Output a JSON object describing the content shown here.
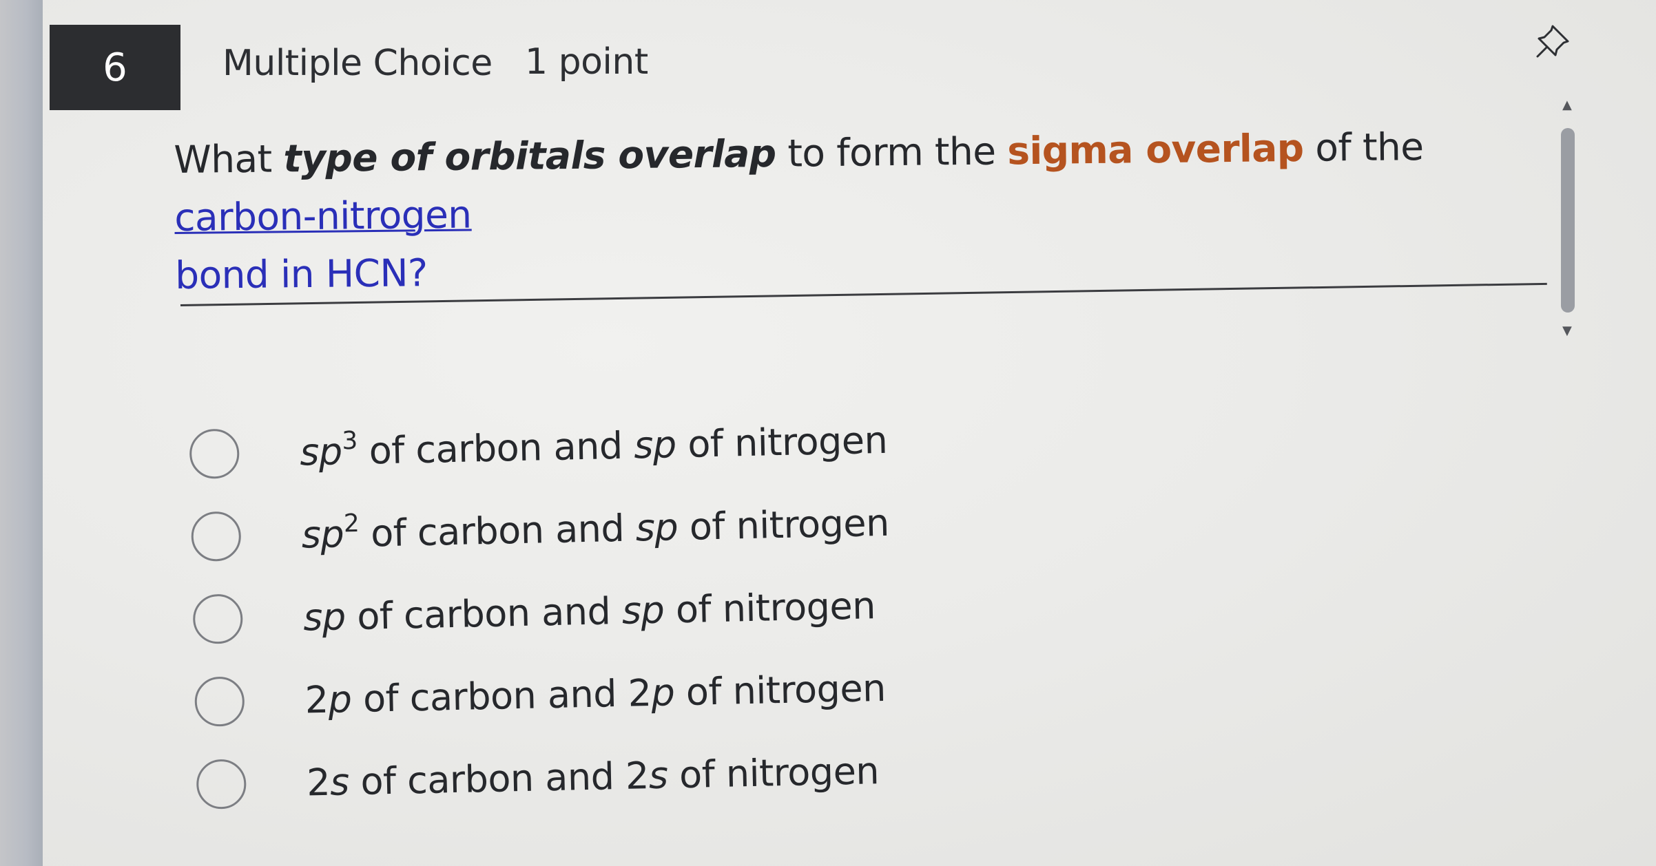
{
  "header": {
    "question_number": "6",
    "question_type": "Multiple Choice",
    "points": "1 point",
    "pin_icon": "pin-icon"
  },
  "question": {
    "part1": "What ",
    "part2_emphasis": "type of orbitals overlap",
    "part3": " to form the ",
    "part4_highlight": "sigma overlap",
    "part5": " of the ",
    "part6_link": "carbon-nitrogen",
    "part7_line2": "bond in HCN?"
  },
  "options": [
    {
      "pre_italic": "sp",
      "sup": "3",
      "rest": " of carbon and ",
      "italic2": "sp",
      "tail": " of nitrogen"
    },
    {
      "pre_italic": "sp",
      "sup": "2",
      "rest": " of carbon and ",
      "italic2": "sp",
      "tail": " of nitrogen"
    },
    {
      "pre_italic": "sp",
      "sup": "",
      "rest": " of carbon and ",
      "italic2": "sp",
      "tail": " of nitrogen"
    },
    {
      "pre_num": "2",
      "pre_italic": "p",
      "rest": " of carbon and 2",
      "italic2": "p",
      "tail": " of nitrogen"
    },
    {
      "pre_num": "2",
      "pre_italic": "s",
      "rest": " of carbon and 2",
      "italic2": "s",
      "tail": " of nitrogen"
    }
  ],
  "colors": {
    "number_badge_bg": "#2c2d30",
    "highlight": "#b5531f",
    "link": "#2a2fb8"
  }
}
